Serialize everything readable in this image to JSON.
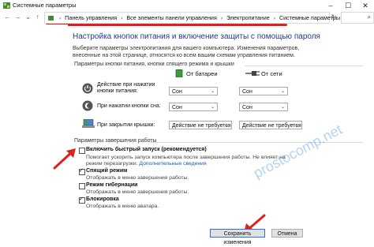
{
  "window": {
    "title": "Системные параметры"
  },
  "breadcrumb": {
    "items": [
      "Панель управления",
      "Все элементы панели управления",
      "Электропитание",
      "Системные параметры"
    ]
  },
  "page": {
    "title": "Настройка кнопок питания и включение защиты с помощью пароля",
    "intro": "Выберите параметры электропитания для вашего компьютера. Изменения параметров, внесенные на этой странице, относятся ко всем вашим схемам управления питанием."
  },
  "buttons_group": {
    "label": "Параметры кнопки питания, кнопки спящего режима и крышки",
    "col_battery": "От батареи",
    "col_power": "От сети",
    "rows": [
      {
        "label": "Действие при нажатии кнопки питания:",
        "battery": "Сон",
        "power": "Сон"
      },
      {
        "label": "При нажатии кнопки сна:",
        "battery": "Сон",
        "power": "Сон"
      },
      {
        "label": "При закрытии крышки:",
        "battery": "Действие не требуется",
        "power": "Действие не требуется"
      }
    ]
  },
  "shutdown_group": {
    "label": "Параметры завершения работы",
    "fast_startup": {
      "title": "Включить быстрый запуск (рекомендуется)",
      "desc_1": "Помогает ускорить запуск компьютера после завершения работы. Не влияет на режим",
      "desc_2": "перезагрузки.",
      "link": "Дополнительные сведения",
      "checked": false
    },
    "sleep": {
      "title": "Спящий режим",
      "desc": "Отображать в меню завершения работы.",
      "checked": true
    },
    "hibernate": {
      "title": "Режим гибернации",
      "desc": "Отображать в меню завершения работы.",
      "checked": false
    },
    "lock": {
      "title": "Блокировка",
      "desc": "Отображать в меню аватара.",
      "checked": true
    }
  },
  "footer": {
    "save": "Сохранить изменения",
    "cancel": "Отмена"
  },
  "watermark": "prostocomp.net",
  "colors": {
    "accent_red": "#e0201c",
    "title_blue": "#1e3a8c",
    "link_blue": "#1a56c7"
  }
}
